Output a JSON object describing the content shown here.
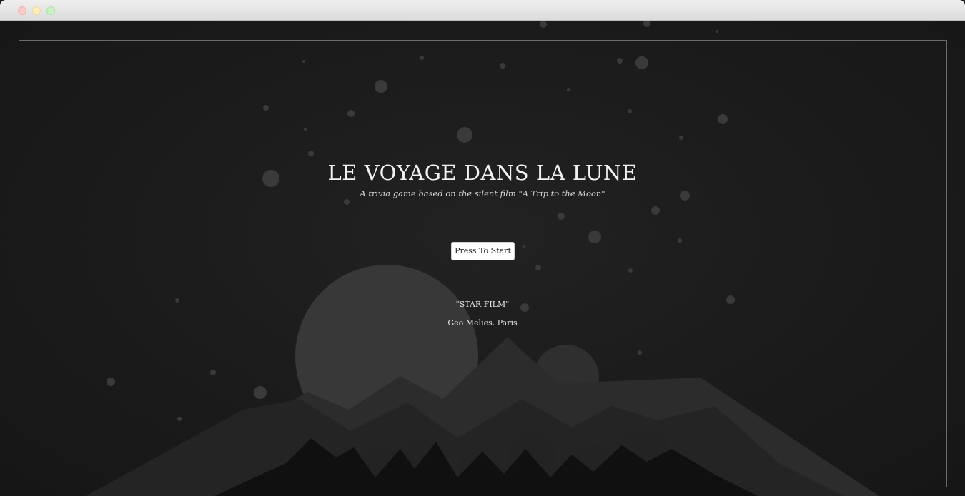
{
  "window": {
    "controls": [
      "close",
      "minimize",
      "maximize"
    ]
  },
  "game": {
    "title": "LE VOYAGE DANS LA LUNE",
    "subtitle": "A trivia game based on the silent film \"A Trip to the Moon\"",
    "start_button_label": "Press To Start",
    "studio_label": "\"STAR FILM\"",
    "maker_label": "Geo Melies. Paris"
  },
  "colors": {
    "background": "#1b1b1b",
    "moon": "#3a3a3a",
    "mountain_back": "#2b2b2b",
    "mountain_front": "#0f0f0f",
    "frame": "#6b6b6b",
    "text": "#f2f2f2"
  }
}
